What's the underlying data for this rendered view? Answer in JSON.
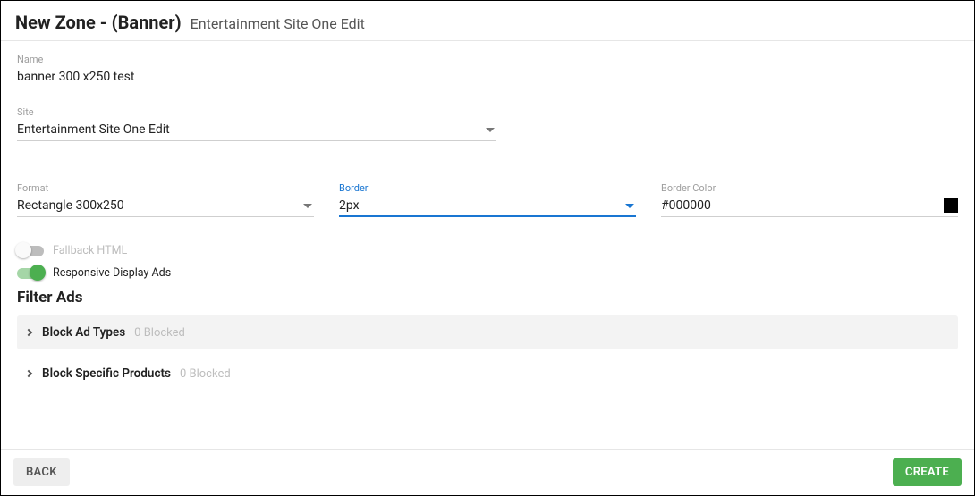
{
  "header": {
    "title": "New Zone - (Banner)",
    "subtitle": "Entertainment Site One Edit"
  },
  "fields": {
    "name": {
      "label": "Name",
      "value": "banner 300 x250 test"
    },
    "site": {
      "label": "Site",
      "value": "Entertainment Site One Edit"
    },
    "format": {
      "label": "Format",
      "value": "Rectangle 300x250"
    },
    "border": {
      "label": "Border",
      "value": "2px"
    },
    "borderColor": {
      "label": "Border Color",
      "value": "#000000",
      "swatch": "#000000"
    }
  },
  "toggles": {
    "fallback": {
      "label": "Fallback HTML",
      "on": false
    },
    "responsive": {
      "label": "Responsive Display Ads",
      "on": true
    }
  },
  "filterAds": {
    "heading": "Filter Ads",
    "blockAdTypes": {
      "title": "Block Ad Types",
      "count": "0 Blocked"
    },
    "blockSpecificProducts": {
      "title": "Block Specific Products",
      "count": "0 Blocked"
    }
  },
  "footer": {
    "back": "BACK",
    "create": "CREATE"
  }
}
